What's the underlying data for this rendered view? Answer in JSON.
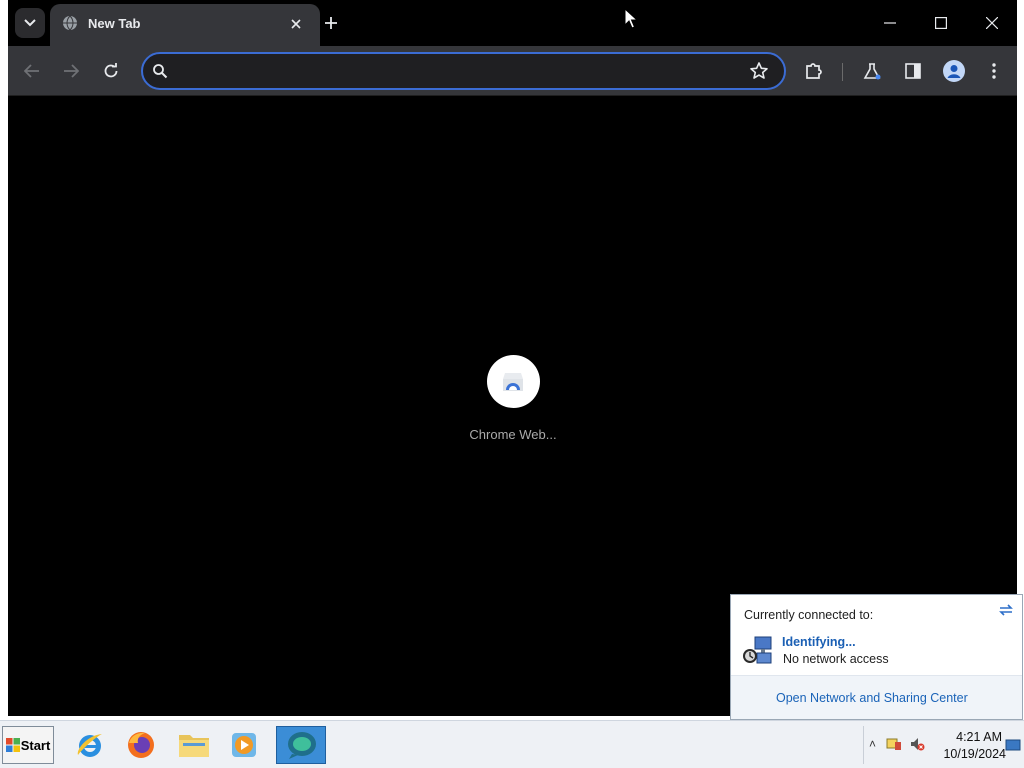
{
  "browser": {
    "tab": {
      "title": "New Tab"
    },
    "omnibox": {
      "value": "",
      "placeholder": ""
    },
    "shortcut": {
      "label": "Chrome Web..."
    }
  },
  "network_flyout": {
    "heading": "Currently connected to:",
    "network_name": "Identifying...",
    "network_status": "No network access",
    "footer_link": "Open Network and Sharing Center"
  },
  "taskbar": {
    "start_label": "Start",
    "apps": [
      "internet-explorer-icon",
      "firefox-icon",
      "file-explorer-icon",
      "media-player-icon",
      "chrome-active-app-icon"
    ],
    "clock": {
      "time": "4:21 AM",
      "date": "10/19/2024"
    }
  },
  "colors": {
    "chrome_frame": "#000000",
    "toolbar": "#35363a",
    "omnibox_focus": "#3b6cd4",
    "link_blue": "#1a63b8",
    "taskbar": "#eef1f5"
  }
}
